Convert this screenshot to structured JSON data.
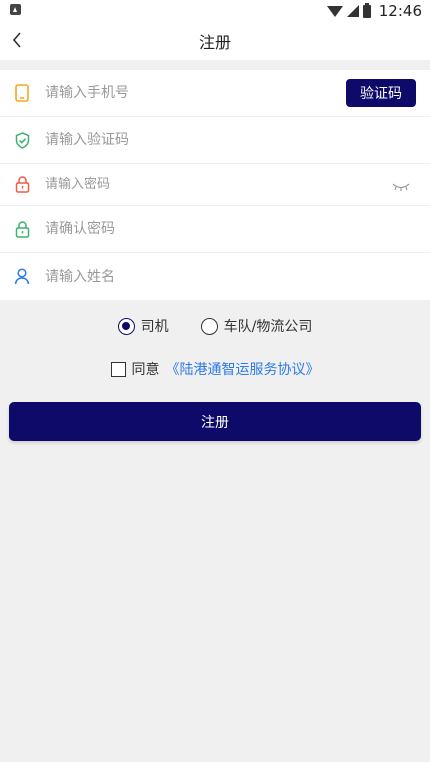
{
  "status_bar": {
    "time": "12:46",
    "icons": [
      "notification-icon",
      "wifi-icon",
      "signal-icon",
      "battery-icon"
    ]
  },
  "header": {
    "title": "注册",
    "back_icon": "chevron-left-icon"
  },
  "form": {
    "phone": {
      "placeholder": "请输入手机号",
      "icon": "phone-icon",
      "icon_color": "#f5a623"
    },
    "get_code_label": "验证码",
    "code": {
      "placeholder": "请输入验证码",
      "icon": "shield-check-icon",
      "icon_color": "#3cb371"
    },
    "password": {
      "placeholder": "请输入密码",
      "icon": "lock-icon",
      "icon_color": "#f05a4a",
      "toggle_icon": "eye-closed-icon"
    },
    "confirm_password": {
      "placeholder": "请确认密码",
      "icon": "lock-icon",
      "icon_color": "#3cb371"
    },
    "name": {
      "placeholder": "请输入姓名",
      "icon": "user-icon",
      "icon_color": "#2d7ae8"
    }
  },
  "roles": {
    "options": [
      "司机",
      "车队/物流公司"
    ],
    "selected": "司机"
  },
  "agreement": {
    "prefix": "同意",
    "link": "《陆港通智运服务协议》",
    "checked": false
  },
  "submit_label": "注册",
  "colors": {
    "primary": "#0d0a69",
    "link": "#2d7ae8",
    "background": "#f0f0f0"
  }
}
